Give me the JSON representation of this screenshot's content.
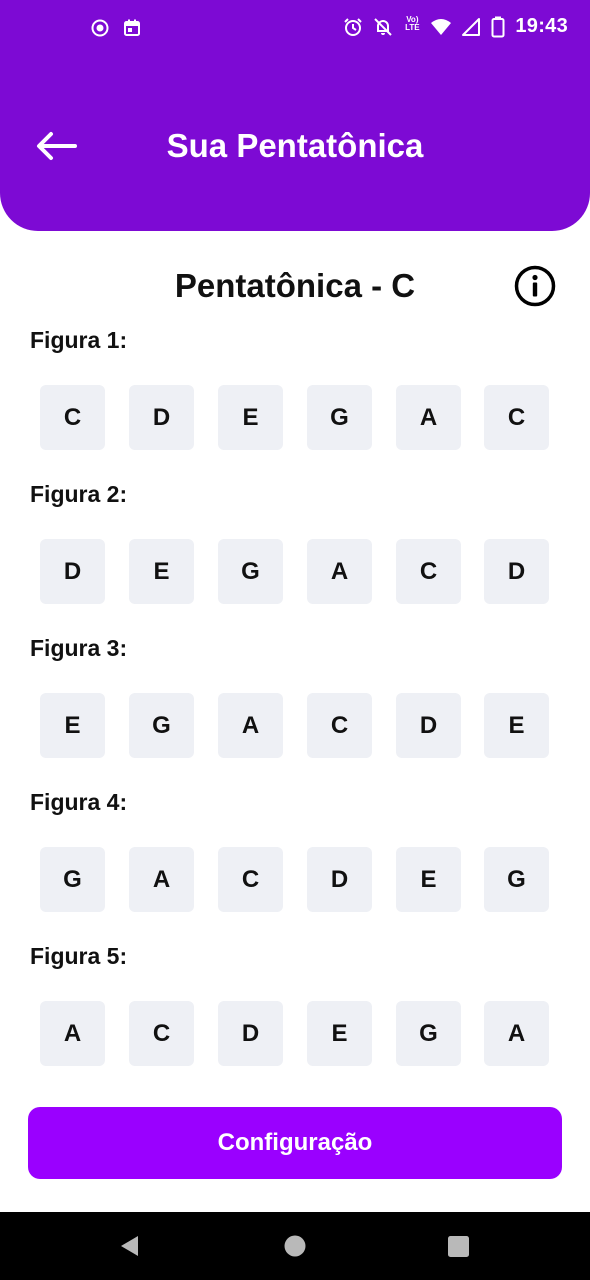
{
  "colors": {
    "header": "#7d0ad4",
    "button": "#9a00ff",
    "note_bg": "#eef0f5",
    "nav_bar": "#000000"
  },
  "status_bar": {
    "time": "19:43",
    "volte_top": "Vo)",
    "volte_bottom": "LTE",
    "icons_left": [
      "screen-record-icon",
      "calendar-icon"
    ],
    "icons_right": [
      "alarm-icon",
      "notifications-off-icon",
      "volte-icon",
      "wifi-icon",
      "signal-icon",
      "battery-icon"
    ]
  },
  "app_bar": {
    "back_icon": "arrow-left-icon",
    "title": "Sua Pentatônica"
  },
  "scale": {
    "title": "Pentatônica - C",
    "info_icon": "info-icon"
  },
  "figures": [
    {
      "label": "Figura 1:",
      "notes": [
        "C",
        "D",
        "E",
        "G",
        "A",
        "C"
      ]
    },
    {
      "label": "Figura 2:",
      "notes": [
        "D",
        "E",
        "G",
        "A",
        "C",
        "D"
      ]
    },
    {
      "label": "Figura 3:",
      "notes": [
        "E",
        "G",
        "A",
        "C",
        "D",
        "E"
      ]
    },
    {
      "label": "Figura 4:",
      "notes": [
        "G",
        "A",
        "C",
        "D",
        "E",
        "G"
      ]
    },
    {
      "label": "Figura 5:",
      "notes": [
        "A",
        "C",
        "D",
        "E",
        "G",
        "A"
      ]
    }
  ],
  "config_button": {
    "label": "Configuração"
  },
  "nav_bar": {
    "icons": [
      "back-triangle-icon",
      "home-circle-icon",
      "recents-square-icon"
    ]
  }
}
